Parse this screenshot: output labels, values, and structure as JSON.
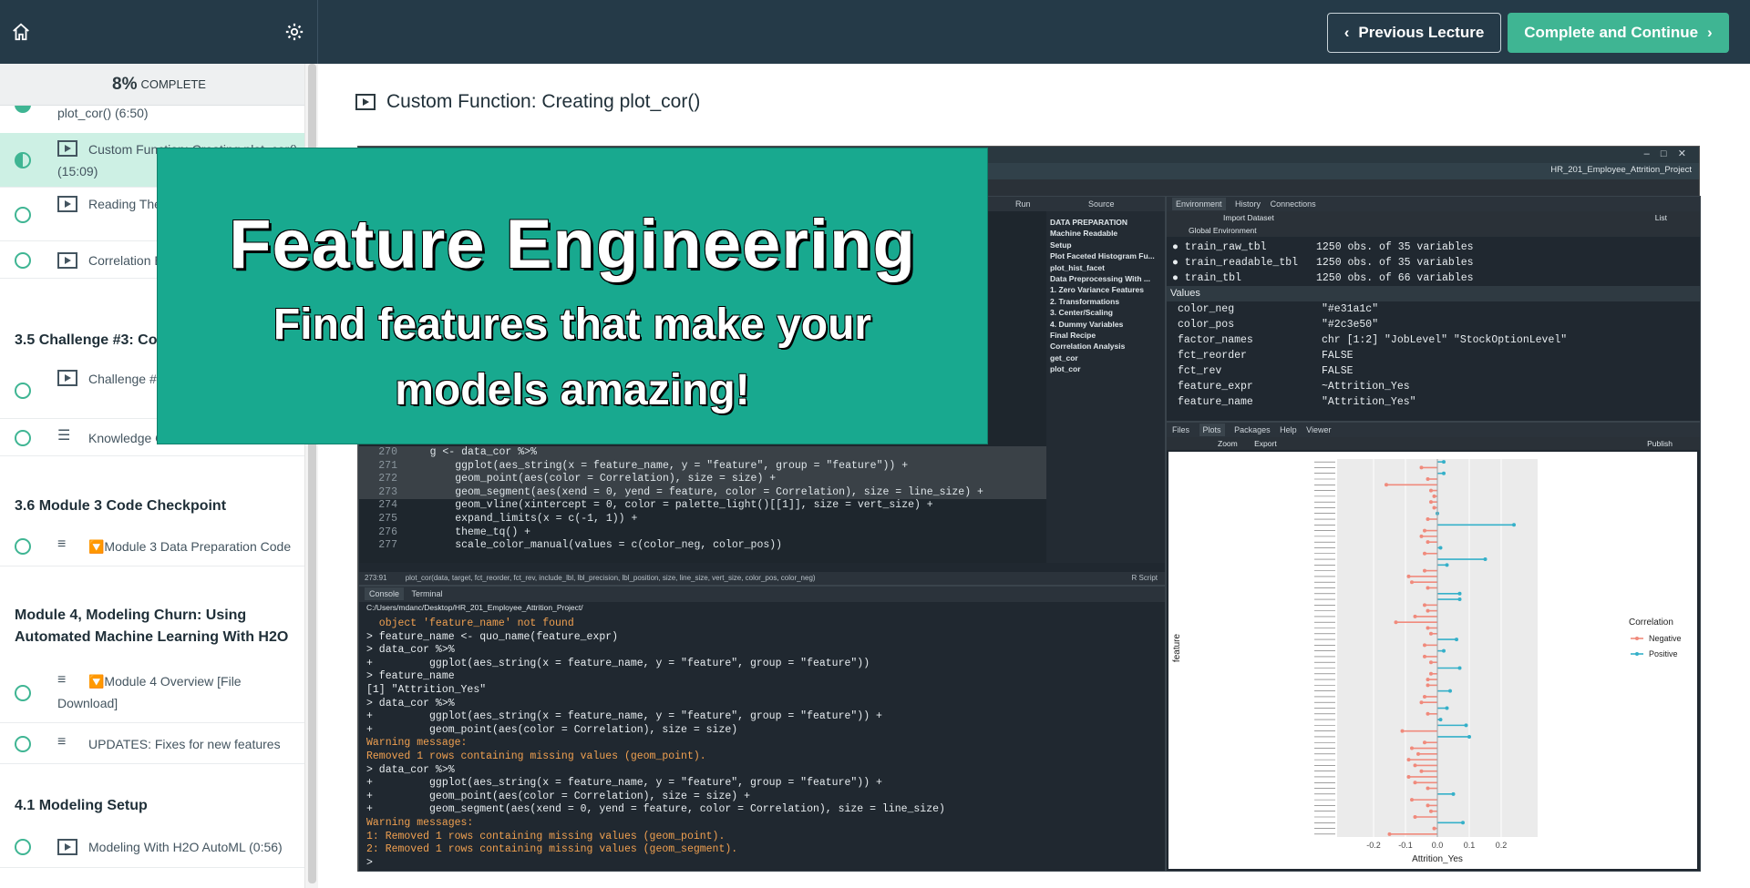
{
  "header": {
    "prev_label": "Previous Lecture",
    "next_label": "Complete and Continue"
  },
  "progress": {
    "percent": "8%",
    "label": "COMPLETE"
  },
  "sidebar": {
    "items": [
      {
        "text": "plot_cor() (6:50)",
        "type": "video",
        "state": "complete"
      },
      {
        "text": "Custom Function: Creating plot_cor() (15:09)",
        "type": "video",
        "state": "active"
      },
      {
        "text": "Reading The Correlation Plot (5:26)",
        "type": "video",
        "state": "open"
      },
      {
        "text": "Correlation Evaluation",
        "type": "video",
        "state": "open"
      },
      {
        "text": "Challenge #3 (0:41)",
        "type": "video",
        "state": "open"
      },
      {
        "text": "Knowledge Check",
        "type": "quiz",
        "state": "open"
      },
      {
        "text": "🔽Module 3 Data Preparation Code",
        "type": "text",
        "state": "open"
      },
      {
        "text": "🔽Module 4 Overview [File Download]",
        "type": "text",
        "state": "open"
      },
      {
        "text": "UPDATES: Fixes for new features",
        "type": "text",
        "state": "open"
      },
      {
        "text": "Modeling With H2O AutoML (0:56)",
        "type": "video",
        "state": "open"
      }
    ],
    "sections": [
      "3.5 Challenge #3: Correlation Evaluation",
      "3.6 Module 3 Code Checkpoint",
      "Module 4, Modeling Churn: Using Automated Machine Learning With H2O",
      "4.1 Modeling Setup"
    ]
  },
  "lecture": {
    "title": "Custom Function: Creating plot_cor()"
  },
  "overlay": {
    "title": "Feature Engineering",
    "subtitle_line1": "Find features that make your",
    "subtitle_line2": "models amazing!"
  },
  "rstudio": {
    "project": "HR_201_Employee_Attrition_Project",
    "editor_lines": [
      {
        "n": "270",
        "code": "    g <- data_cor %>%"
      },
      {
        "n": "271",
        "code": "        ggplot(aes_string(x = feature_name, y = \"feature\", group = \"feature\")) +"
      },
      {
        "n": "272",
        "code": "        geom_point(aes(color = Correlation), size = size) +"
      },
      {
        "n": "273",
        "code": "        geom_segment(aes(xend = 0, yend = feature, color = Correlation), size = line_size) +"
      },
      {
        "n": "274",
        "code": "        geom_vline(xintercept = 0, color = palette_light()[[1]], size = vert_size) +"
      },
      {
        "n": "275",
        "code": "        expand_limits(x = c(-1, 1)) +"
      },
      {
        "n": "276",
        "code": "        theme_tq() +"
      },
      {
        "n": "277",
        "code": "        scale_color_manual(values = c(color_neg, color_pos))"
      }
    ],
    "editor_status": "plot_cor(data, target, fct_reorder, fct_rev, include_lbl, lbl_precision, lbl_position, size, line_size, vert_size, color_pos, color_neg)",
    "editor_pos": "273:91",
    "editor_type": "R Script",
    "outline": [
      "DATA PREPARATION",
      "Machine Readable",
      "Setup",
      "Plot Faceted Histogram Fu...",
      "plot_hist_facet",
      "Data Preprocessing With ...",
      "1. Zero Variance Features",
      "2. Transformations",
      "3. Center/Scaling",
      "4. Dummy Variables",
      "Final Recipe",
      "Correlation Analysis",
      "get_cor",
      "plot_cor"
    ],
    "toolbar": {
      "run": "Run",
      "source": "Source"
    },
    "console_tabs": [
      "Console",
      "Terminal"
    ],
    "console_path": "C:/Users/mdanc/Desktop/HR_201_Employee_Attrition_Project/",
    "console_lines": [
      {
        "t": "  object 'feature_name' not found",
        "c": "o"
      },
      {
        "t": "> feature_name <- quo_name(feature_expr)",
        "c": "w"
      },
      {
        "t": "> data_cor %>%",
        "c": "w"
      },
      {
        "t": "+         ggplot(aes_string(x = feature_name, y = \"feature\", group = \"feature\"))",
        "c": "w"
      },
      {
        "t": "> feature_name",
        "c": "w"
      },
      {
        "t": "[1] \"Attrition_Yes\"",
        "c": "w"
      },
      {
        "t": "> data_cor %>%",
        "c": "w"
      },
      {
        "t": "+         ggplot(aes_string(x = feature_name, y = \"feature\", group = \"feature\")) +",
        "c": "w"
      },
      {
        "t": "+         geom_point(aes(color = Correlation), size = size)",
        "c": "w"
      },
      {
        "t": "Warning message:",
        "c": "o"
      },
      {
        "t": "Removed 1 rows containing missing values (geom_point).",
        "c": "o"
      },
      {
        "t": "> data_cor %>%",
        "c": "w"
      },
      {
        "t": "+         ggplot(aes_string(x = feature_name, y = \"feature\", group = \"feature\")) +",
        "c": "w"
      },
      {
        "t": "+         geom_point(aes(color = Correlation), size = size) +",
        "c": "w"
      },
      {
        "t": "+         geom_segment(aes(xend = 0, yend = feature, color = Correlation), size = line_size)",
        "c": "w"
      },
      {
        "t": "Warning messages:",
        "c": "o"
      },
      {
        "t": "1: Removed 1 rows containing missing values (geom_point).",
        "c": "o"
      },
      {
        "t": "2: Removed 1 rows containing missing values (geom_segment).",
        "c": "o"
      },
      {
        "t": ">",
        "c": "w"
      }
    ],
    "env_tabs": [
      "Environment",
      "History",
      "Connections"
    ],
    "env_import": "Import Dataset",
    "env_global": "Global Environment",
    "env_list": "List",
    "env_data": [
      {
        "name": "train_raw_tbl",
        "value": "1250 obs. of 35 variables"
      },
      {
        "name": "train_readable_tbl",
        "value": "1250 obs. of 35 variables"
      },
      {
        "name": "train_tbl",
        "value": "1250 obs. of 66 variables"
      }
    ],
    "env_values_header": "Values",
    "env_values": [
      {
        "name": "color_neg",
        "value": "\"#e31a1c\""
      },
      {
        "name": "color_pos",
        "value": "\"#2c3e50\""
      },
      {
        "name": "factor_names",
        "value": "chr [1:2] \"JobLevel\" \"StockOptionLevel\""
      },
      {
        "name": "fct_reorder",
        "value": "FALSE"
      },
      {
        "name": "fct_rev",
        "value": "FALSE"
      },
      {
        "name": "feature_expr",
        "value": "~Attrition_Yes"
      },
      {
        "name": "feature_name",
        "value": "\"Attrition_Yes\""
      }
    ],
    "plot_tabs": [
      "Files",
      "Plots",
      "Packages",
      "Help",
      "Viewer"
    ],
    "plot_tools": {
      "zoom": "Zoom",
      "export": "Export",
      "publish": "Publish"
    }
  },
  "colors": {
    "accent": "#3fb593",
    "header_bg": "#253a48",
    "overlay_bg": "#18a98f",
    "neg": "#f08a7c",
    "pos": "#35b0c9"
  },
  "chart_data": {
    "type": "bar",
    "title": "",
    "xlabel": "Attrition_Yes",
    "ylabel": "feature",
    "xlim": [
      -0.3,
      0.3
    ],
    "xticks": [
      "-0.2",
      "-0.1",
      "0.0",
      "0.1",
      "0.2"
    ],
    "legend": {
      "title": "Correlation",
      "entries": [
        "Negative",
        "Positive"
      ],
      "placement": "right"
    },
    "grid": true,
    "values": [
      0.02,
      -0.05,
      0.02,
      -0.03,
      -0.16,
      -0.02,
      -0.01,
      -0.02,
      -0.01,
      0.0,
      -0.03,
      0.24,
      -0.04,
      -0.05,
      -0.03,
      0.01,
      -0.04,
      0.15,
      0.03,
      -0.04,
      -0.09,
      -0.08,
      -0.03,
      0.07,
      0.07,
      -0.04,
      -0.03,
      -0.07,
      -0.13,
      -0.03,
      -0.02,
      0.06,
      -0.04,
      0.02,
      -0.04,
      -0.02,
      0.07,
      -0.02,
      -0.03,
      -0.03,
      0.04,
      -0.04,
      -0.05,
      0.03,
      -0.03,
      0.01,
      0.09,
      -0.11,
      0.1,
      -0.04,
      -0.08,
      -0.06,
      -0.09,
      -0.07,
      -0.05,
      -0.09,
      -0.07,
      -0.03,
      0.05,
      -0.08,
      -0.03,
      -0.02,
      -0.07,
      0.08,
      -0.01,
      -0.15
    ]
  }
}
